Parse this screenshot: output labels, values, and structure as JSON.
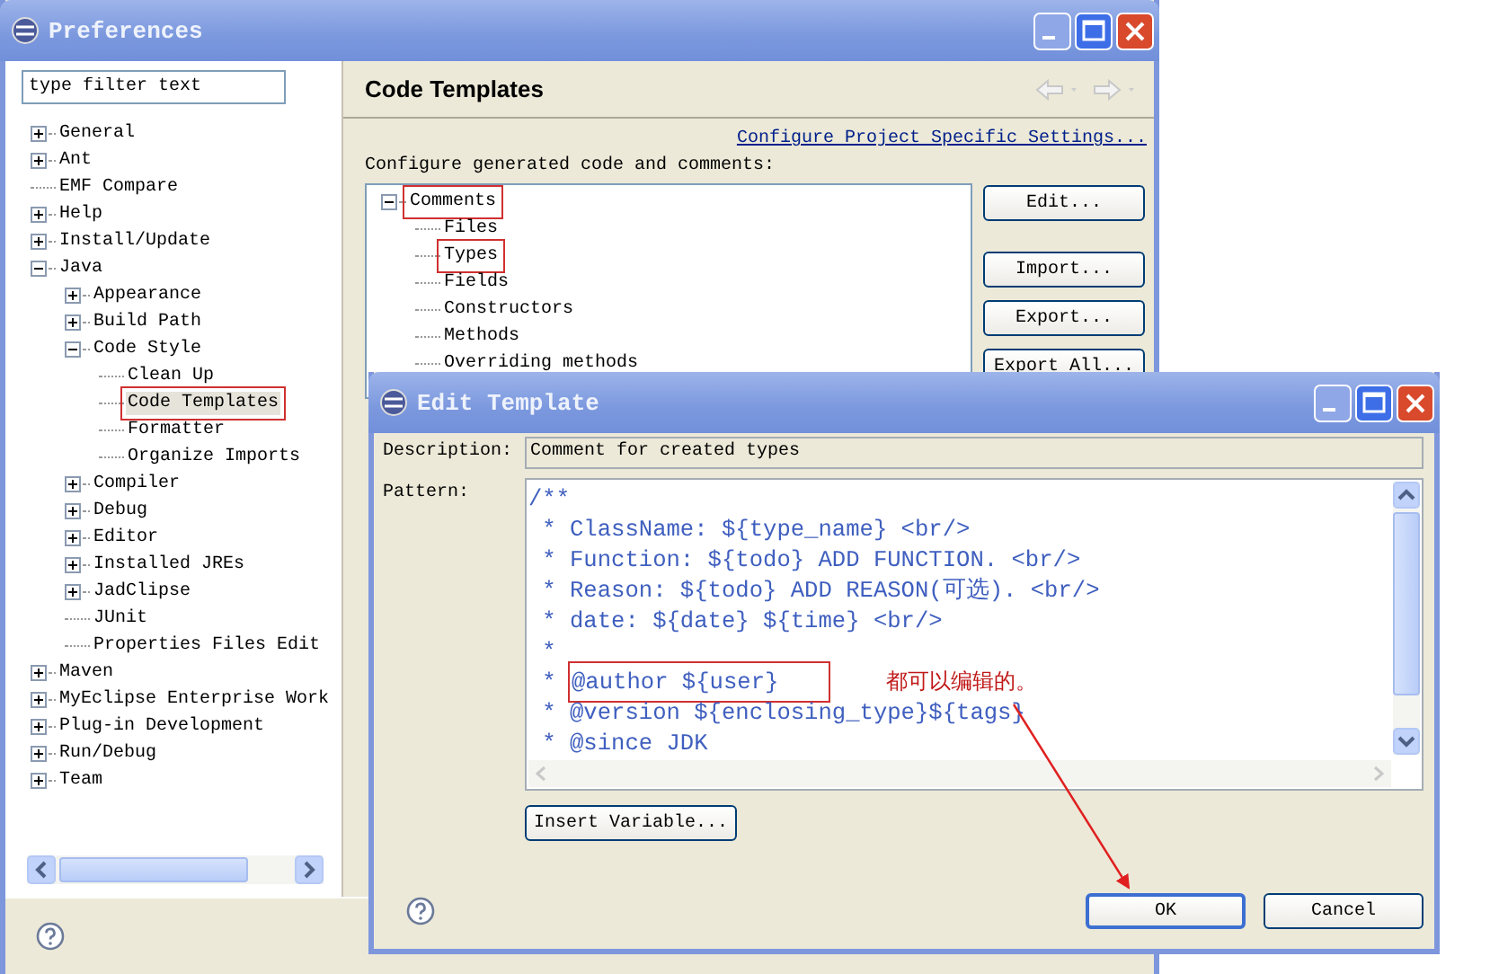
{
  "preferences": {
    "title": "Preferences",
    "filter": {
      "placeholder": "type filter text"
    },
    "tree": [
      {
        "label": "General",
        "expanded": false,
        "selected": false,
        "marked": false
      },
      {
        "label": "Ant",
        "expanded": false,
        "selected": false,
        "marked": false
      },
      {
        "label": "EMF Compare",
        "selected": false,
        "marked": false
      },
      {
        "label": "Help",
        "expanded": false,
        "selected": false,
        "marked": false
      },
      {
        "label": "Install/Update",
        "expanded": false,
        "selected": false,
        "marked": false
      },
      {
        "label": "Java",
        "expanded": true,
        "selected": false,
        "marked": false,
        "children": [
          {
            "label": "Appearance",
            "expanded": false,
            "selected": false,
            "marked": false
          },
          {
            "label": "Build Path",
            "expanded": false,
            "selected": false,
            "marked": false
          },
          {
            "label": "Code Style",
            "expanded": true,
            "selected": false,
            "marked": false,
            "children": [
              {
                "label": "Clean Up",
                "selected": false,
                "marked": false
              },
              {
                "label": "Code Templates",
                "selected": true,
                "marked": true
              },
              {
                "label": "Formatter",
                "selected": false,
                "marked": false
              },
              {
                "label": "Organize Imports",
                "selected": false,
                "marked": false
              }
            ]
          },
          {
            "label": "Compiler",
            "expanded": false,
            "selected": false,
            "marked": false
          },
          {
            "label": "Debug",
            "expanded": false,
            "selected": false,
            "marked": false
          },
          {
            "label": "Editor",
            "expanded": false,
            "selected": false,
            "marked": false
          },
          {
            "label": "Installed JREs",
            "expanded": false,
            "selected": false,
            "marked": false
          },
          {
            "label": "JadClipse",
            "expanded": false,
            "selected": false,
            "marked": false
          },
          {
            "label": "JUnit",
            "selected": false,
            "marked": false
          },
          {
            "label": "Properties Files Edit",
            "selected": false,
            "marked": false
          }
        ]
      },
      {
        "label": "Maven",
        "expanded": false,
        "selected": false,
        "marked": false
      },
      {
        "label": "MyEclipse Enterprise Work",
        "expanded": false,
        "selected": false,
        "marked": false
      },
      {
        "label": "Plug-in Development",
        "expanded": false,
        "selected": false,
        "marked": false
      },
      {
        "label": "Run/Debug",
        "expanded": false,
        "selected": false,
        "marked": false
      },
      {
        "label": "Team",
        "expanded": false,
        "selected": false,
        "marked": false
      }
    ],
    "page": {
      "title": "Code Templates",
      "link": "Configure Project Specific Settings...",
      "label": "Configure generated code and comments:",
      "templates": [
        {
          "label": "Comments",
          "expanded": true,
          "selected": false,
          "marked": true,
          "children": [
            {
              "label": "Files",
              "selected": false,
              "marked": false
            },
            {
              "label": "Types",
              "selected": false,
              "marked": true
            },
            {
              "label": "Fields",
              "selected": false,
              "marked": false
            },
            {
              "label": "Constructors",
              "selected": false,
              "marked": false
            },
            {
              "label": "Methods",
              "selected": false,
              "marked": false
            },
            {
              "label": "Overriding methods",
              "selected": false,
              "marked": false
            }
          ]
        }
      ],
      "buttons": [
        "Edit...",
        "Import...",
        "Export...",
        "Export All..."
      ]
    }
  },
  "dialog": {
    "title": "Edit Template",
    "description_label": "Description:",
    "description": "Comment for created types",
    "pattern_label": "Pattern:",
    "pattern": [
      {
        "text": "/**",
        "marked": false
      },
      {
        "prefix": " * ",
        "text": "ClassName: ${type_name} <br/>",
        "marked": false
      },
      {
        "prefix": " * ",
        "text": "Function: ${todo} ADD FUNCTION. <br/>",
        "marked": false
      },
      {
        "prefix": " * ",
        "text": "Reason: ${todo} ADD REASON(可选). <br/>",
        "marked": false
      },
      {
        "prefix": " * ",
        "text": "date: ${date} ${time} <br/>",
        "marked": false
      },
      {
        "prefix": " *",
        "marked": false
      },
      {
        "prefix": " * ",
        "text": "@author ${user}",
        "marked": true
      },
      {
        "prefix": " * ",
        "text": "@version ${enclosing_type}${tags}",
        "marked": false
      },
      {
        "prefix": " * ",
        "text": "@since JDK",
        "marked": false
      }
    ],
    "insert_button": "Insert Variable...",
    "buttons": [
      {
        "label": "OK",
        "default": true
      },
      {
        "label": "Cancel",
        "default": false
      }
    ]
  },
  "annotation": {
    "note": "都可以编辑的。"
  }
}
